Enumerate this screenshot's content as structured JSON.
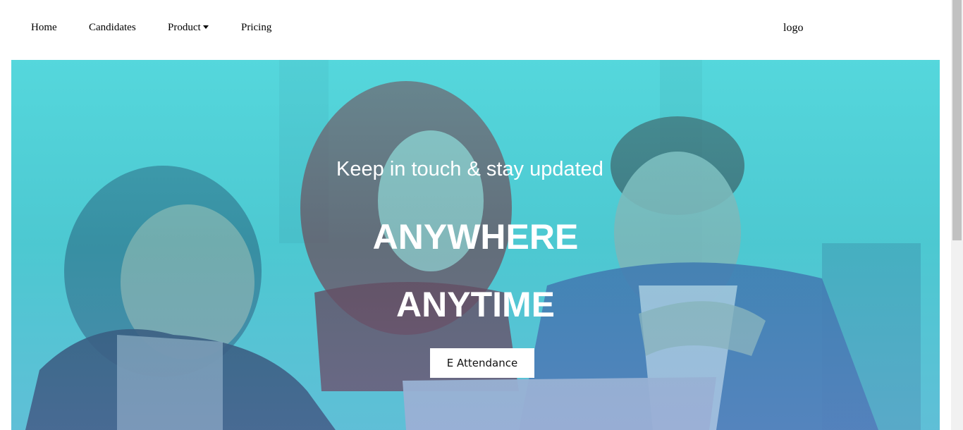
{
  "nav": {
    "items": [
      {
        "label": "Home"
      },
      {
        "label": "Candidates"
      },
      {
        "label": "Product"
      },
      {
        "label": "Pricing"
      }
    ],
    "logo_alt": "logo"
  },
  "hero": {
    "tagline": "Keep in touch & stay updated",
    "line1": "ANYWHERE",
    "line2": "ANYTIME",
    "cta_label": "E Attendance"
  },
  "colors": {
    "hero_tint_top": "#5fe0e2",
    "hero_tint_bottom": "#6f9fcf",
    "text_on_hero": "#ffffff",
    "button_bg": "#ffffff"
  }
}
